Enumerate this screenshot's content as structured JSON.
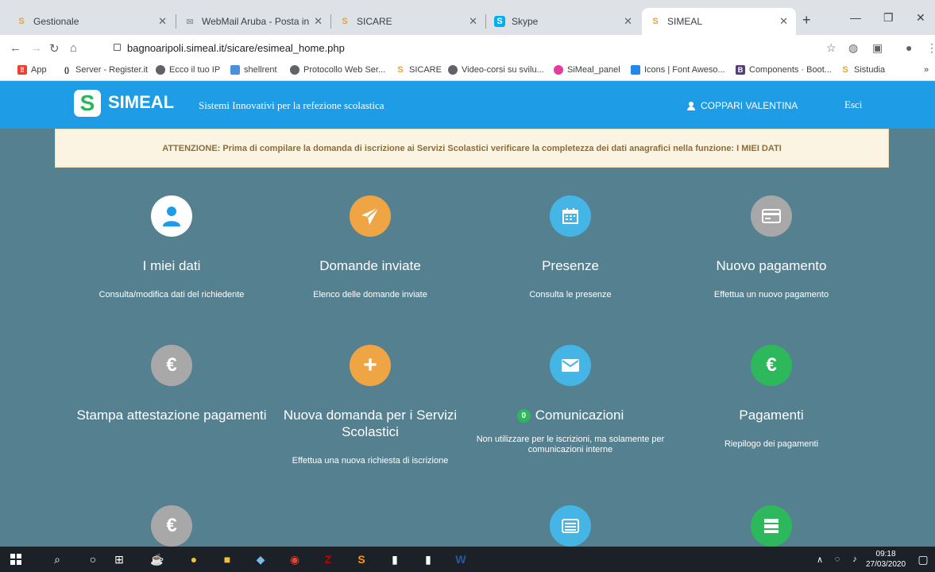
{
  "browser": {
    "tabs": [
      {
        "title": "Gestionale",
        "favicon": "simeal-s-icon",
        "color": "#e6a23c"
      },
      {
        "title": "WebMail Aruba - Posta in arriv",
        "favicon": "webmail-icon",
        "color": "#9aa0a6"
      },
      {
        "title": "SICARE",
        "favicon": "simeal-s-icon",
        "color": "#e6a23c"
      },
      {
        "title": "Skype",
        "favicon": "skype-icon",
        "color": "#00aff0"
      },
      {
        "title": "SIMEAL",
        "favicon": "simeal-s-icon",
        "color": "#e6a23c"
      }
    ],
    "new_tab": "+",
    "url": "bagnoaripoli.simeal.it/sicare/esimeal_home.php",
    "bookmarks": [
      {
        "label": "App"
      },
      {
        "label": "Server - Register.it"
      },
      {
        "label": "Ecco il tuo IP"
      },
      {
        "label": "shellrent"
      },
      {
        "label": "Protocollo Web Ser..."
      },
      {
        "label": "SICARE"
      },
      {
        "label": "Video-corsi su svilu..."
      },
      {
        "label": "SiMeal_panel"
      },
      {
        "label": "Icons | Font Aweso..."
      },
      {
        "label": "Components · Boot..."
      },
      {
        "label": "Sistudia"
      }
    ]
  },
  "header": {
    "logo": "SIMEAL",
    "slogan": "Sistemi Innovativi per la refezione scolastica",
    "user": "COPPARI VALENTINA",
    "logout": "Esci"
  },
  "alert": "ATTENZIONE: Prima di compilare la domanda di iscrizione ai Servizi Scolastici verificare la completezza dei dati anagrafici nella funzione: I MIEI DATI",
  "tiles": [
    {
      "title": "I miei dati",
      "desc": "Consulta/modifica dati del richiedente",
      "icon": "user-icon",
      "color": "#1e9ce6"
    },
    {
      "title": "Domande inviate",
      "desc": "Elenco delle domande inviate",
      "icon": "paper-plane-icon",
      "color": "#f0a544"
    },
    {
      "title": "Presenze",
      "desc": "Consulta le presenze",
      "icon": "calendar-icon",
      "color": "#44b5e5"
    },
    {
      "title": "Nuovo pagamento",
      "desc": "Effettua un nuovo pagamento",
      "icon": "credit-card-icon",
      "color": "#a8a8a8"
    },
    {
      "title": "Stampa attestazione pagamenti",
      "desc": "",
      "icon": "euro-icon",
      "color": "#a8a8a8"
    },
    {
      "title": "Nuova domanda per i Servizi Scolastici",
      "desc": "Effettua una nuova richiesta di iscrizione",
      "icon": "plus-icon",
      "color": "#f0a544"
    },
    {
      "title": "Comunicazioni",
      "badge": "0",
      "desc": "Non utilizzare per le iscrizioni, ma solamente per comunicazioni interne",
      "icon": "envelope-icon",
      "color": "#44b5e5"
    },
    {
      "title": "Pagamenti",
      "desc": "Riepilogo dei pagamenti",
      "icon": "euro-icon",
      "color": "#2eb85c"
    }
  ],
  "taskbar": {
    "time": "09:18",
    "date": "27/03/2020"
  }
}
